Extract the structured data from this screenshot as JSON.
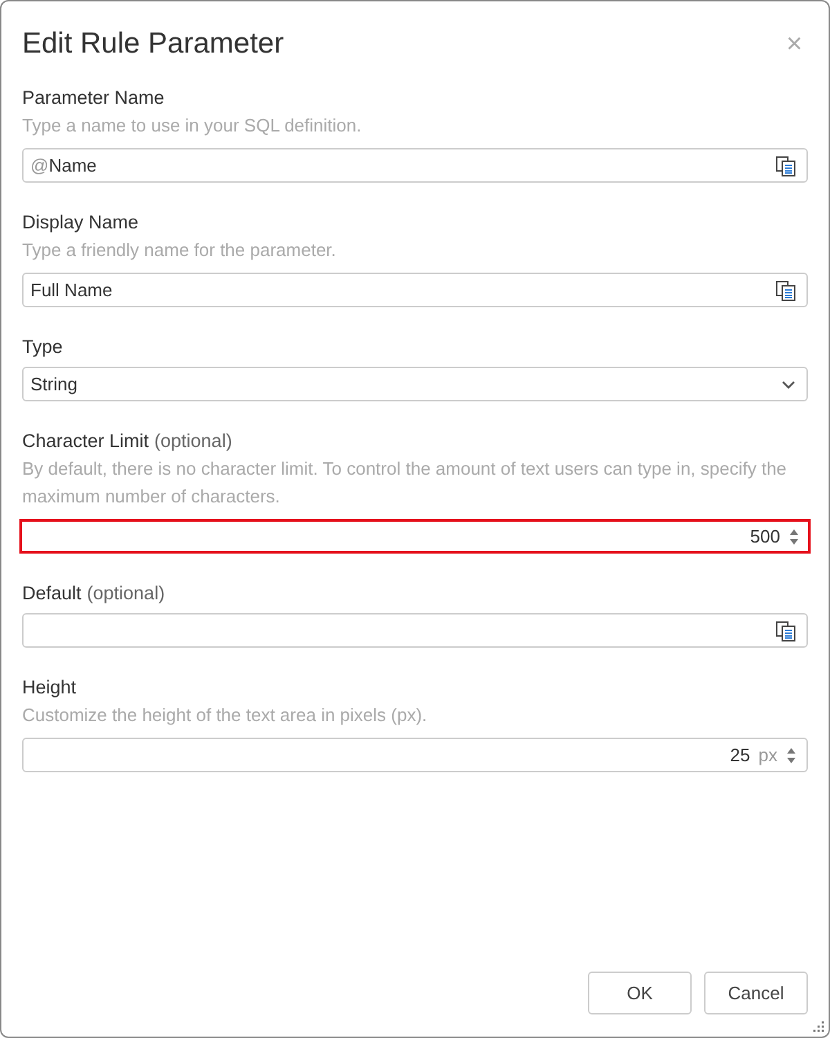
{
  "dialog": {
    "title": "Edit Rule Parameter",
    "close": "×"
  },
  "fields": [
    {
      "kind": "text",
      "label": "Parameter Name",
      "hint": "Type a name to use in your SQL definition.",
      "prefix": "@",
      "value": "Name",
      "focused": false
    },
    {
      "kind": "text",
      "label": "Display Name",
      "hint": "Type a friendly name for the parameter.",
      "value": "Full Name",
      "focused": false
    },
    {
      "kind": "select",
      "label": "Type",
      "value": "String",
      "focused": false
    },
    {
      "kind": "number",
      "label": "Character Limit",
      "label_note": "(optional)",
      "hint": "By default, there is no character limit. To control the amount of text users can type in, specify the maximum number of characters.",
      "value": "500",
      "focused": true
    },
    {
      "kind": "text",
      "label": "Default",
      "label_note": "(optional)",
      "focused": false
    },
    {
      "kind": "number",
      "label": "Height",
      "hint": "Customize the height of the text area in pixels (px).",
      "value": "25",
      "unit": "px",
      "focused": false
    }
  ],
  "buttons": [
    "OK",
    "Cancel"
  ]
}
